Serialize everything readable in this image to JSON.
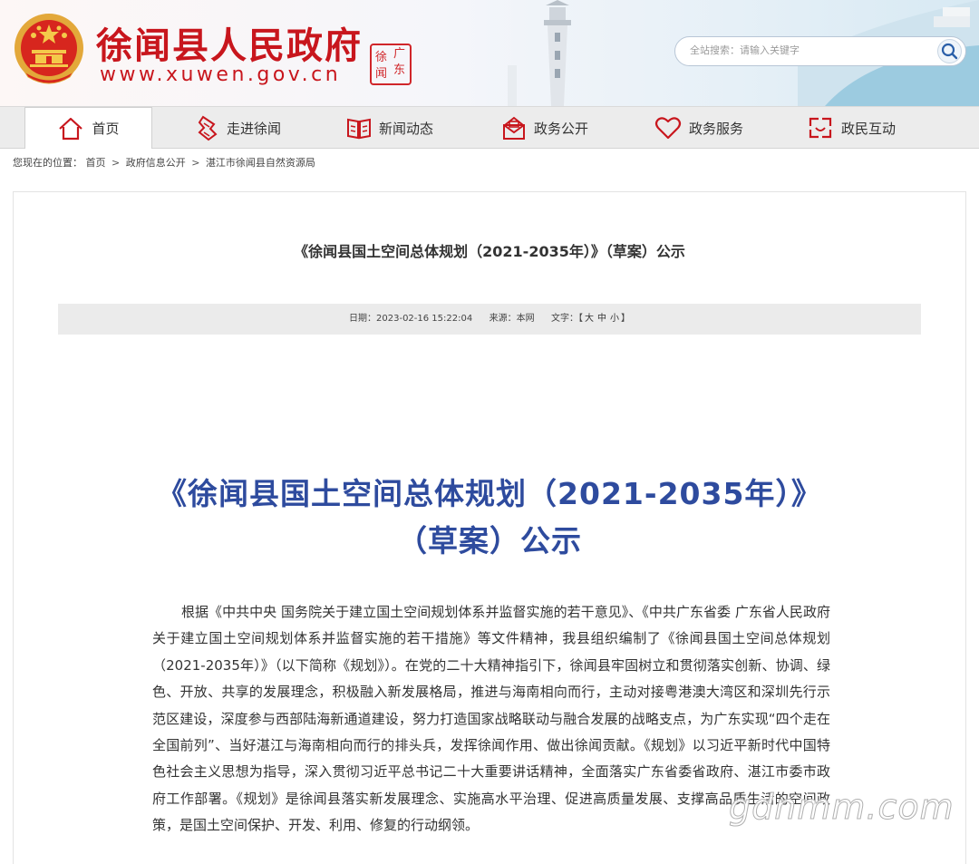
{
  "header": {
    "site_name": "徐闻县人民政府",
    "site_url": "www.xuwen.gov.cn",
    "seal_chars": [
      "徐",
      "广",
      "闻",
      "东"
    ],
    "search_placeholder": "全站搜索：请输入关键字",
    "brand_color": "#c8161d"
  },
  "nav": {
    "items": [
      {
        "label": "首页",
        "icon": "home-icon"
      },
      {
        "label": "走进徐闻",
        "icon": "scroll-icon"
      },
      {
        "label": "新闻动态",
        "icon": "book-icon"
      },
      {
        "label": "政务公开",
        "icon": "mail-icon"
      },
      {
        "label": "政务服务",
        "icon": "heart-icon"
      },
      {
        "label": "政民互动",
        "icon": "chat-icon"
      }
    ]
  },
  "breadcrumb": {
    "prefix": "您现在的位置：",
    "items": [
      "首页",
      "政府信息公开",
      "湛江市徐闻县自然资源局"
    ],
    "separator": ">"
  },
  "article": {
    "title": "《徐闻县国土空间总体规划（2021-2035年）》（草案）公示",
    "meta": {
      "date_label": "日期：",
      "date": "2023-02-16 15:22:04",
      "source_label": "来源：",
      "source": "本网",
      "font_label": "文字：",
      "bracket_open": "【",
      "font_large": "大",
      "font_medium": "中",
      "font_small": "小",
      "bracket_close": "】"
    },
    "headline_line1": "《徐闻县国土空间总体规划（2021-2035年）》",
    "headline_line2": "（草案）公示",
    "headline_color": "#2e4b9e",
    "paragraph": "根据《中共中央 国务院关于建立国土空间规划体系并监督实施的若干意见》、《中共广东省委 广东省人民政府关于建立国土空间规划体系并监督实施的若干措施》等文件精神，我县组织编制了《徐闻县国土空间总体规划（2021-2035年）》（以下简称《规划》）。在党的二十大精神指引下，徐闻县牢固树立和贯彻落实创新、协调、绿色、开放、共享的发展理念，积极融入新发展格局，推进与海南相向而行，主动对接粤港澳大湾区和深圳先行示范区建设，深度参与西部陆海新通道建设，努力打造国家战略联动与融合发展的战略支点，为广东实现“四个走在全国前列”、当好湛江与海南相向而行的排头兵，发挥徐闻作用、做出徐闻贡献。《规划》以习近平新时代中国特色社会主义思想为指导，深入贯彻习近平总书记二十大重要讲话精神，全面落实广东省委省政府、湛江市委市政府工作部署。《规划》是徐闻县落实新发展理念、实施高水平治理、促进高质量发展、支撑高品质生活的空间政策，是国土空间保护、开发、利用、修复的行动纲领。"
  },
  "watermark": "gdnmm.com"
}
